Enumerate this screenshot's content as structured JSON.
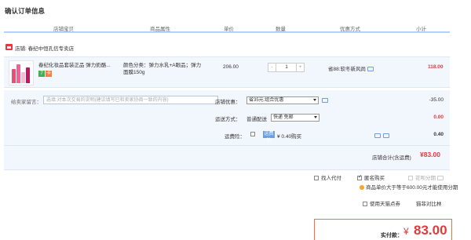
{
  "page_title": "确认订单信息",
  "table_headers": [
    "店铺宝贝",
    "商品属性",
    "单价",
    "数量",
    "优惠方式",
    "小计"
  ],
  "shop": {
    "label": "店铺: 春纪中恒孔信专卖店"
  },
  "item": {
    "name": "春纪化妆品套装正品 弹力奶酪...",
    "badges": [
      "7",
      "卡"
    ],
    "attributes": "颜色分类：弹力水乳+A眼品；弹力面膜150g",
    "price": "206.00",
    "quantity": "1",
    "minus": "-",
    "plus": "+",
    "promotion": "省88:软冬新风尚",
    "subtotal": "118.00"
  },
  "options": {
    "message_label": "给卖家留言：",
    "message_placeholder": "选填:对本次交易的说明(建议填写已和卖家协商一致的内容)",
    "shop_discount_label": "店铺优惠：",
    "shop_discount_value": "省35元:组合优惠",
    "shop_discount_amount": "-35.00",
    "shipping_label": "运送方式：",
    "shipping_type": "普通配送",
    "shipping_value": "快递 免邮",
    "shipping_amount": "0.00",
    "insurance_label": "运费险：",
    "insurance_badge": "运费险",
    "insurance_price": "¥ 0.40购买",
    "insurance_amount": "0.40",
    "shop_total_label": "店铺合计(含运费)",
    "shop_total": "¥83.00"
  },
  "checkboxes": {
    "proxy_pay": "找人代付",
    "anonymous": "匿名购买",
    "huabei": "花呗分期",
    "tip": "商品单价大于等于600.00元才能使用分期",
    "tmall_points": "使用天猫点券",
    "points_rules": "猫菲对比林"
  },
  "payment": {
    "label": "实付款：",
    "yen": "¥",
    "amount": "83.00"
  },
  "colors": {
    "accent_red": "#e4393c",
    "row_bg": "#f2f6fd",
    "header_line": "#b2d1ff",
    "pay_border": "#ff6a3d"
  }
}
